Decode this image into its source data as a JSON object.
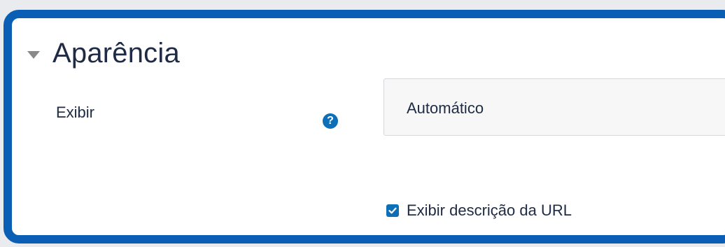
{
  "section": {
    "title": "Aparência",
    "collapse_icon": "caret-down-icon"
  },
  "display_field": {
    "label": "Exibir",
    "help_icon": "question-circle-icon",
    "help_glyph": "?",
    "selected_value": "Automático"
  },
  "options": {
    "show_description_label": "Exibir descrição da URL",
    "show_description_checked": true
  },
  "colors": {
    "accent": "#0d6fb8",
    "frame_border": "#0a5fb4",
    "text": "#1f2a44"
  }
}
